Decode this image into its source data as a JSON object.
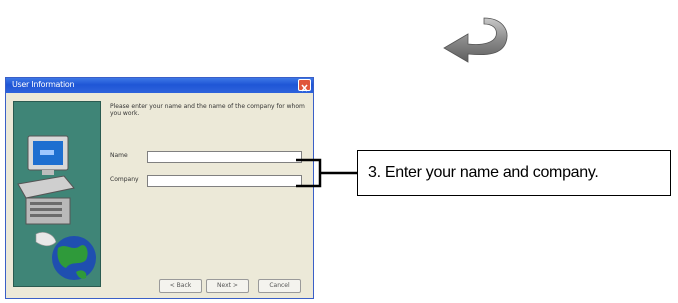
{
  "dialog": {
    "title": "User Information",
    "instructions": "Please enter your name and the name of the company for whom you work.",
    "name_label": "Name",
    "name_value": "",
    "company_label": "Company",
    "company_value": "",
    "back_label": "< Back",
    "next_label": "Next >",
    "cancel_label": "Cancel"
  },
  "callout": {
    "text": "3. Enter your name and company."
  },
  "icons": {
    "top": "curved-arrow-icon",
    "side": "computer-globe-illustration"
  },
  "colors": {
    "titlebar": "#245edb",
    "side_panel": "#3f8577",
    "dialog_bg": "#ece9d8",
    "close": "#e0563a"
  }
}
